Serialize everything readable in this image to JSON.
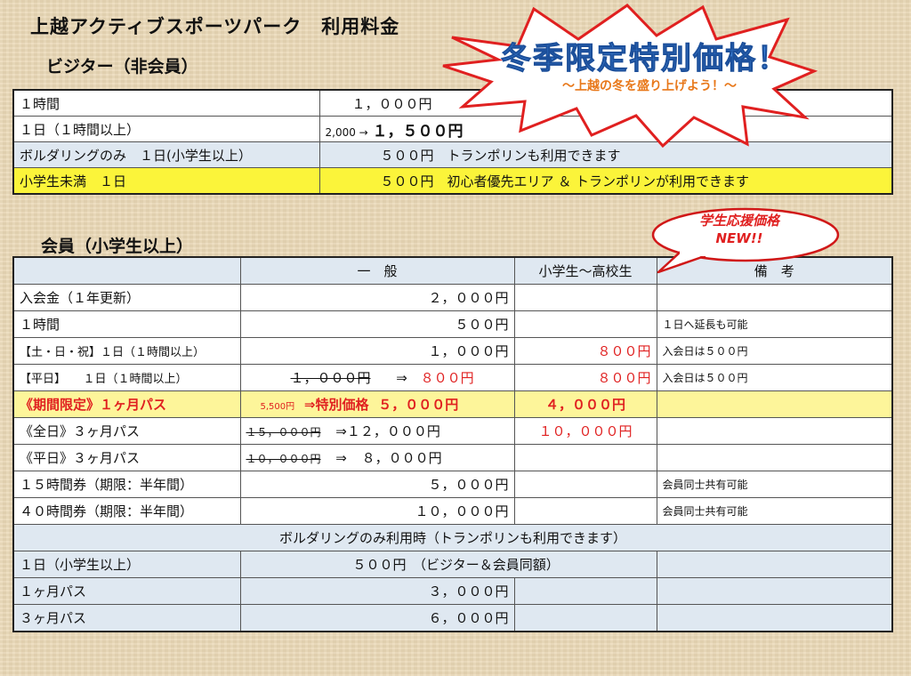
{
  "title": "上越アクティブスポーツパーク　利用料金",
  "promo": {
    "title": "冬季限定特別価格！",
    "subtitle": "〜上越の冬を盛り上げよう！〜"
  },
  "student_bubble": {
    "line1": "学生応援価格",
    "line2": "NEW!!"
  },
  "visitor": {
    "heading": "ビジター（非会員）",
    "rows": [
      {
        "label": "１時間",
        "price": "１，０００円"
      },
      {
        "label": "１日（１時間以上）",
        "old_price": "2,000 →",
        "price": "１，５００円"
      },
      {
        "label": "ボルダリングのみ　１日(小学生以上）",
        "price": "５００円　トランポリンも利用できます"
      },
      {
        "label": "小学生未満　１日",
        "price": "５００円　初心者優先エリア ＆ トランポリンが利用できます"
      }
    ]
  },
  "member": {
    "heading": "会員（小学生以上）",
    "headers": {
      "general": "一　般",
      "student": "小学生〜高校生",
      "note": "備　考"
    },
    "rows": [
      {
        "label": "入会金（１年更新）",
        "general": "２，０００円",
        "student": "",
        "note": ""
      },
      {
        "label": "１時間",
        "general": "５００円",
        "student": "",
        "note": "１日へ延長も可能"
      },
      {
        "label": "【土・日・祝】１日（１時間以上）",
        "general": "１，０００円",
        "student": "８００円",
        "note": "入会日は５００円"
      },
      {
        "label": "【平日】　　１日（１時間以上）",
        "general_old": "１，０００円",
        "arrow": "⇒",
        "general": "８００円",
        "student": "８００円",
        "note": "入会日は５００円"
      },
      {
        "label": "《期間限定》１ヶ月パス",
        "general_old": "5,500円",
        "general_prefix": "⇒特別価格",
        "general": "５，０００円",
        "student": "４，０００円",
        "note": ""
      },
      {
        "label": "《全日》３ヶ月パス",
        "general_old": "１５，０００円",
        "arrow": "⇒",
        "general": "１２，０００円",
        "student": "１０，０００円",
        "note": ""
      },
      {
        "label": "《平日》３ヶ月パス",
        "general_old": "１０，０００円",
        "arrow": "⇒",
        "general": "８，０００円",
        "student": "",
        "note": ""
      },
      {
        "label": "１５時間券（期限：半年間）",
        "general": "５，０００円",
        "student": "",
        "note": "会員同士共有可能"
      },
      {
        "label": "４０時間券（期限：半年間）",
        "general": "１０，０００円",
        "student": "",
        "note": "会員同士共有可能"
      }
    ],
    "bouldering_heading": "ボルダリングのみ利用時（トランポリンも利用できます）",
    "bouldering_rows": [
      {
        "label": "１日（小学生以上）",
        "general": "５００円　（ビジター＆会員同額）"
      },
      {
        "label": "１ヶ月パス",
        "general": "３，０００円"
      },
      {
        "label": "３ヶ月パス",
        "general": "６，０００円"
      }
    ]
  },
  "colors": {
    "accent_red": "#e02020",
    "promo_blue": "#3a7fd6",
    "promo_orange": "#e8781a",
    "highlight_yellow": "#fbf43a",
    "row_blue": "#dfe8f1"
  }
}
